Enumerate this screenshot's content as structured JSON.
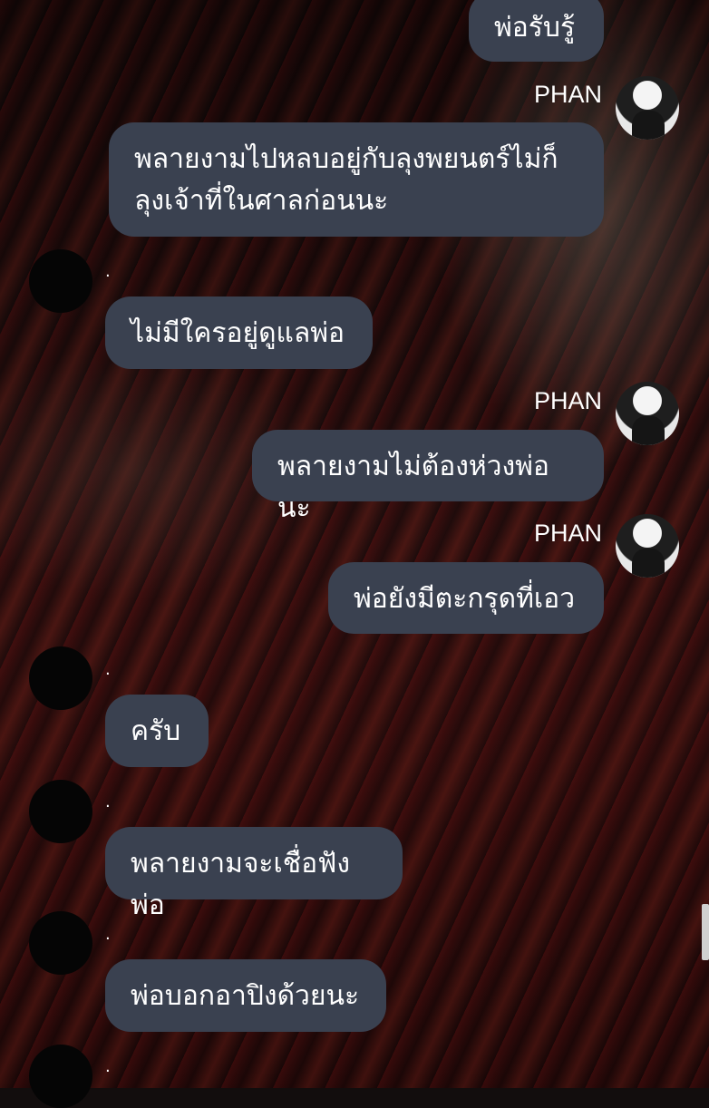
{
  "chat": {
    "messages": [
      {
        "side": "right",
        "text": "พ่อรับรู้"
      },
      {
        "side": "right",
        "sender": "PHAN",
        "text": "พลายงามไปหลบอยู่กับลุงพยนตร์ไม่ก็\nลุงเจ้าที่ในศาลก่อนนะ"
      },
      {
        "side": "left",
        "sender": ".",
        "text": "ไม่มีใครอยู่ดูแลพ่อ"
      },
      {
        "side": "right",
        "sender": "PHAN",
        "text": "พลายงามไม่ต้องห่วงพ่อนะ"
      },
      {
        "side": "right",
        "sender": "PHAN",
        "text": "พ่อยังมีตะกรุดที่เอว"
      },
      {
        "side": "left",
        "sender": ".",
        "text": "ครับ"
      },
      {
        "side": "left",
        "sender": ".",
        "text": "พลายงามจะเชื่อฟังพ่อ"
      },
      {
        "side": "left",
        "sender": ".",
        "text": "พ่อบอกอาปิงด้วยนะ"
      },
      {
        "side": "left",
        "sender": "."
      }
    ]
  },
  "colors": {
    "bubble": "#3a4150",
    "text": "#ffffff"
  }
}
